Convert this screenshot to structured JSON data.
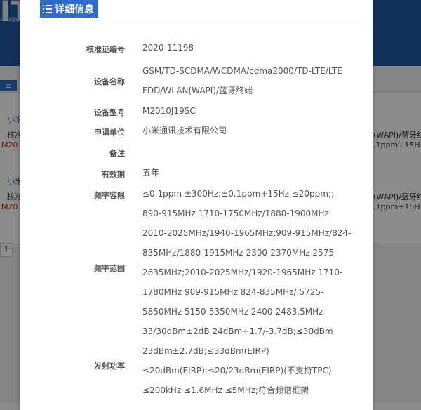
{
  "background": {
    "logo": "IT",
    "tagline": "ology",
    "menu_icon": "menu-icon",
    "panel_rows": [
      {
        "title": "小米",
        "line1": "核准",
        "line2": "M20",
        "right1": "(WAPI)/蓝牙终",
        "right2": ".1ppm+15H"
      },
      {
        "title": "小米",
        "line1": "核准",
        "line2": "M20",
        "right1": "(WAPI)/蓝牙终",
        "right2": ".1ppm+15H"
      }
    ],
    "page_number": "1"
  },
  "modal": {
    "title": "详细信息",
    "title_icon": "list-icon",
    "fields": {
      "approval_no": {
        "label": "核准证编号",
        "value": "2020-11198"
      },
      "device_name": {
        "label": "设备名称",
        "lines": [
          "GSM/TD-SCDMA/WCDMA/cdma2000/TD-LTE/LTE",
          "FDD/WLAN(WAPI)/蓝牙终端"
        ]
      },
      "model": {
        "label": "设备型号",
        "value": "M2010J19SC"
      },
      "applicant": {
        "label": "申请单位",
        "value": "小米通讯技术有限公司"
      },
      "remark": {
        "label": "备注",
        "value": ""
      },
      "validity": {
        "label": "有效期",
        "value": "五年"
      },
      "freq_tolerance": {
        "label": "频率容限",
        "value": "≤0.1ppm ±300Hz;±0.1ppm+15Hz ≤20ppm;;"
      },
      "freq_range": {
        "label": "频率范围",
        "lines": [
          "890-915MHz 1710-1750MHz/1880-1900MHz",
          "2010-2025MHz/1940-1965MHz;909-915MHz/824-",
          "835MHz/1880-1915MHz 2300-2370MHz 2575-",
          "2635MHz;2010-2025MHz/1920-1965MHz 1710-",
          "1780MHz 909-915MHz 824-835MHz/;5725-",
          "5850MHz 5150-5350MHz 2400-2483.5MHz"
        ]
      },
      "tx_power": {
        "label": "发射功率",
        "lines": [
          "33/30dBm±2dB 24dBm+1.7/-3.7dB;≤30dBm",
          "23dBm±2.7dB;≤33dBm(EIRP)",
          "≤20dBm(EIRP);≤20/23dBm(EIRP)(不支持TPC)",
          "≤200kHz ≤1.6MHz ≤5MHz;符合频谱框架"
        ]
      }
    }
  }
}
